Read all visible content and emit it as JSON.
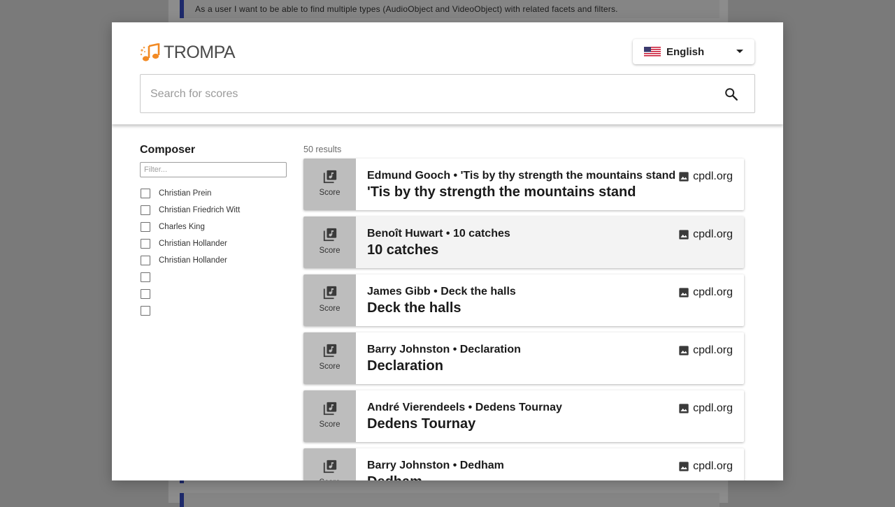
{
  "background": {
    "story_text": "As a user I want to be able to find multiple types (AudioObject and VideoObject) with related facets and filters."
  },
  "header": {
    "logo_text": "TROMPA",
    "language": {
      "selected": "English",
      "flag_icon": "us-flag-icon"
    },
    "search": {
      "placeholder": "Search for scores",
      "value": "",
      "icon": "search-icon"
    }
  },
  "facets": {
    "title": "Composer",
    "filter_placeholder": "Filter...",
    "options": [
      {
        "label": "Christian Prein",
        "checked": false
      },
      {
        "label": "Christian Friedrich Witt",
        "checked": false
      },
      {
        "label": "Charles King",
        "checked": false
      },
      {
        "label": "Christian Hollander",
        "checked": false
      },
      {
        "label": "Christian Hollander",
        "checked": false
      },
      {
        "label": "",
        "checked": false
      },
      {
        "label": "",
        "checked": false
      },
      {
        "label": "",
        "checked": false
      }
    ]
  },
  "results": {
    "count_label": "50 results",
    "items": [
      {
        "type": "Score",
        "subtitle": "Edmund Gooch • 'Tis by thy strength the mountains stand",
        "title": "'Tis by thy strength the mountains stand",
        "source": "cpdl.org"
      },
      {
        "type": "Score",
        "subtitle": "Benoît Huwart • 10 catches",
        "title": "10 catches",
        "source": "cpdl.org"
      },
      {
        "type": "Score",
        "subtitle": "James Gibb • Deck the halls",
        "title": "Deck the halls",
        "source": "cpdl.org"
      },
      {
        "type": "Score",
        "subtitle": "Barry Johnston • Declaration",
        "title": "Declaration",
        "source": "cpdl.org"
      },
      {
        "type": "Score",
        "subtitle": "André Vierendeels • Dedens Tournay",
        "title": "Dedens Tournay",
        "source": "cpdl.org"
      },
      {
        "type": "Score",
        "subtitle": "Barry Johnston • Dedham",
        "title": "Dedham",
        "source": "cpdl.org"
      }
    ]
  }
}
